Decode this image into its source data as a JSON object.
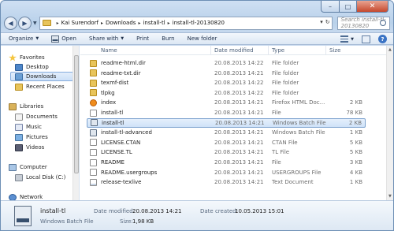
{
  "window": {
    "caption_buttons": {
      "minimize": "–",
      "maximize": "□",
      "close": "✕"
    }
  },
  "nav": {
    "back": "◀",
    "forward": "▶",
    "recent_dropdown": "▼",
    "breadcrumbs": [
      "Kai Surendorf",
      "Downloads",
      "install-tl",
      "install-tl-20130820"
    ],
    "separator": "▸",
    "address_dropdown": "▾",
    "refresh": "↻",
    "search_placeholder": "Search install-tl-20130820"
  },
  "toolbar": {
    "organize": "Organize",
    "open": "Open",
    "share_with": "Share with",
    "print": "Print",
    "burn": "Burn",
    "new_folder": "New folder",
    "dropdown": "▼",
    "help": "?"
  },
  "sidebar": {
    "favorites": "Favorites",
    "favorites_items": [
      "Desktop",
      "Downloads",
      "Recent Places"
    ],
    "libraries": "Libraries",
    "libraries_items": [
      "Documents",
      "Music",
      "Pictures",
      "Videos"
    ],
    "computer": "Computer",
    "computer_items": [
      "Local Disk (C:)"
    ],
    "network": "Network"
  },
  "columns": {
    "name": "Name",
    "date": "Date modified",
    "type": "Type",
    "size": "Size"
  },
  "files": [
    {
      "name": "readme-html.dir",
      "date": "20.08.2013 14:22",
      "type": "File folder",
      "size": "",
      "icon": "folder-icon"
    },
    {
      "name": "readme-txt.dir",
      "date": "20.08.2013 14:21",
      "type": "File folder",
      "size": "",
      "icon": "folder-icon"
    },
    {
      "name": "texmf-dist",
      "date": "20.08.2013 14:22",
      "type": "File folder",
      "size": "",
      "icon": "folder-icon"
    },
    {
      "name": "tlpkg",
      "date": "20.08.2013 14:22",
      "type": "File folder",
      "size": "",
      "icon": "folder-icon"
    },
    {
      "name": "index",
      "date": "20.08.2013 14:21",
      "type": "Firefox HTML Doc...",
      "size": "2 KB",
      "icon": "firefox-document-icon"
    },
    {
      "name": "install-tl",
      "date": "20.08.2013 14:21",
      "type": "File",
      "size": "78 KB",
      "icon": "file-icon"
    },
    {
      "name": "install-tl",
      "date": "20.08.2013 14:21",
      "type": "Windows Batch File",
      "size": "2 KB",
      "icon": "batch-file-icon"
    },
    {
      "name": "install-tl-advanced",
      "date": "20.08.2013 14:21",
      "type": "Windows Batch File",
      "size": "1 KB",
      "icon": "batch-file-icon"
    },
    {
      "name": "LICENSE.CTAN",
      "date": "20.08.2013 14:21",
      "type": "CTAN File",
      "size": "5 KB",
      "icon": "file-icon"
    },
    {
      "name": "LICENSE.TL",
      "date": "20.08.2013 14:21",
      "type": "TL File",
      "size": "5 KB",
      "icon": "file-icon"
    },
    {
      "name": "README",
      "date": "20.08.2013 14:21",
      "type": "File",
      "size": "3 KB",
      "icon": "file-icon"
    },
    {
      "name": "README.usergroups",
      "date": "20.08.2013 14:21",
      "type": "USERGROUPS File",
      "size": "4 KB",
      "icon": "file-icon"
    },
    {
      "name": "release-texlive",
      "date": "20.08.2013 14:21",
      "type": "Text Document",
      "size": "1 KB",
      "icon": "text-document-icon"
    }
  ],
  "selected_index": 6,
  "details": {
    "name": "install-tl",
    "type": "Windows Batch File",
    "date_modified_label": "Date modified:",
    "date_modified": "20.08.2013 14:21",
    "date_created_label": "Date created:",
    "date_created": "10.05.2013 15:01",
    "size_label": "Size:",
    "size": "1,98 KB"
  }
}
